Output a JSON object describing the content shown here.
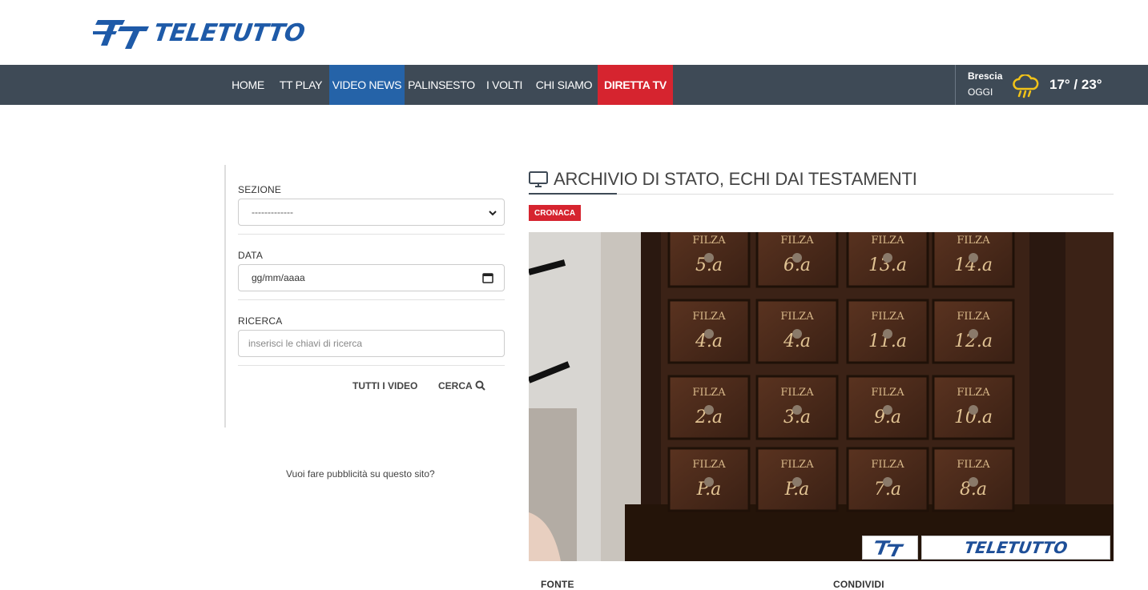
{
  "brand": {
    "logo_text": "TELETUTTO"
  },
  "nav": {
    "items": [
      {
        "label": "HOME",
        "state": "normal"
      },
      {
        "label": "TT PLAY",
        "state": "normal"
      },
      {
        "label": "VIDEO NEWS",
        "state": "active"
      },
      {
        "label": "PALINSESTO",
        "state": "normal"
      },
      {
        "label": "I VOLTI",
        "state": "normal"
      },
      {
        "label": "CHI SIAMO",
        "state": "normal"
      },
      {
        "label": "DIRETTA TV",
        "state": "live"
      }
    ]
  },
  "weather": {
    "city": "Brescia",
    "day": "OGGI",
    "temp": "17° / 23°",
    "icon": "rain-cloud-icon"
  },
  "filters": {
    "section_label": "SEZIONE",
    "section_value": "-------------",
    "date_label": "DATA",
    "date_placeholder": "gg/mm/aaaa",
    "search_label": "RICERCA",
    "search_placeholder": "inserisci le chiavi di ricerca",
    "all_videos_label": "TUTTI I VIDEO",
    "search_button_label": "CERCA"
  },
  "ad_text": "Vuoi fare pubblicità su questo sito?",
  "article": {
    "title": "ARCHIVIO DI STATO, ECHI DAI TESTAMENTI",
    "category": "CRONACA",
    "watermark_text": "TELETUTTO",
    "source_label": "FONTE",
    "share_label": "CONDIVIDI"
  },
  "video_drawers": {
    "rows": [
      [
        "FILZA 5.a",
        "FILZA 6.a",
        "FILZA 13.a",
        "FILZA 14.a"
      ],
      [
        "FILZA 4.a",
        "FILZA 4.a",
        "FILZA 11.a",
        "FILZA 12.a"
      ],
      [
        "FILZA 2.a",
        "FILZA 3.a",
        "FILZA 9.a",
        "FILZA 10.a"
      ],
      [
        "FILZA P.a",
        "FILZA P.a",
        "FILZA 7.a",
        "FILZA 8.a"
      ]
    ]
  },
  "colors": {
    "navbar": "#3e4a56",
    "active": "#2563a8",
    "live": "#d6242f",
    "brand": "#1e5aa8"
  }
}
